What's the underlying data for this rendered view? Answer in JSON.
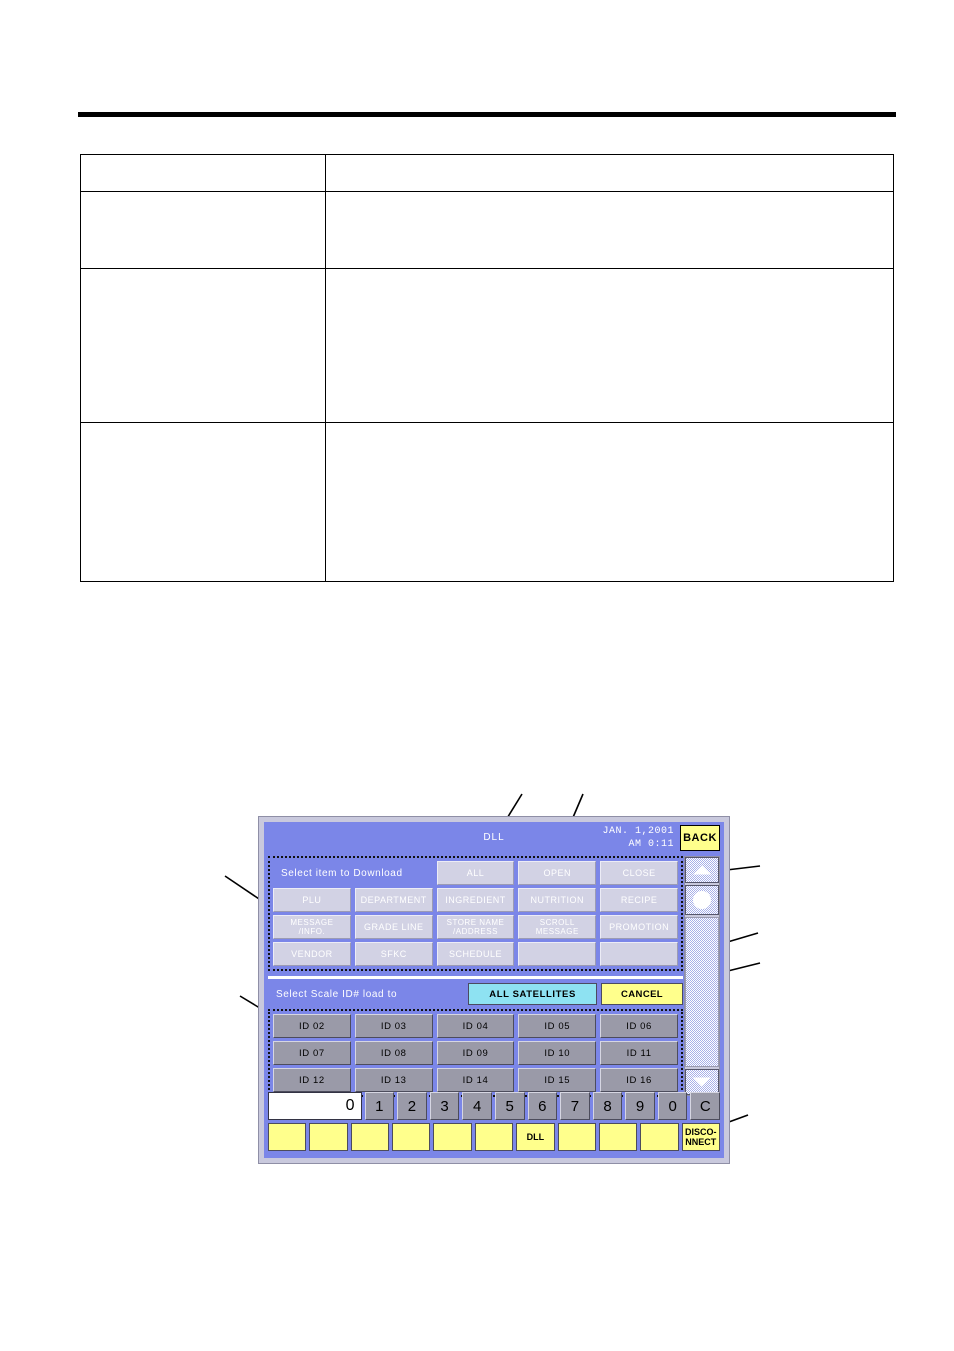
{
  "document": {
    "table": {
      "rows": [
        {
          "left": "",
          "right": ""
        },
        {
          "left": "",
          "right": ""
        },
        {
          "left": "",
          "right": ""
        }
      ]
    }
  },
  "device": {
    "titlebar": {
      "title": "DLL",
      "date": "JAN. 1,2001",
      "time": "AM 0:11",
      "back_label": "BACK"
    },
    "download_group": {
      "label": "Select item to Download",
      "top_buttons": [
        "ALL",
        "OPEN",
        "CLOSE"
      ],
      "grid": [
        [
          "PLU",
          "DEPARTMENT",
          "INGREDIENT",
          "NUTRITION",
          "RECIPE"
        ],
        [
          "MESSAGE\n/INFO.",
          "GRADE LINE",
          "STORE NAME\n/ADDRESS",
          "SCROLL\nMESSAGE",
          "PROMOTION"
        ],
        [
          "VENDOR",
          "SFKC",
          "SCHEDULE",
          "",
          ""
        ]
      ]
    },
    "scale_group": {
      "label": "Select Scale ID# load to",
      "all_satellites_label": "ALL SATELLITES",
      "cancel_label": "CANCEL",
      "ids": [
        [
          "ID 02",
          "ID 03",
          "ID 04",
          "ID 05",
          "ID 06"
        ],
        [
          "ID 07",
          "ID 08",
          "ID 09",
          "ID 10",
          "ID 11"
        ],
        [
          "ID 12",
          "ID 13",
          "ID 14",
          "ID 15",
          "ID 16"
        ]
      ]
    },
    "scrollbar": {
      "up_icon": "triangle-up-icon",
      "thumb_icon": "circle-thumb-icon",
      "down_icon": "triangle-down-icon"
    },
    "keypad": {
      "display_value": "0",
      "keys": [
        "1",
        "2",
        "3",
        "4",
        "5",
        "6",
        "7",
        "8",
        "9",
        "0",
        "C"
      ],
      "function_keys": [
        "",
        "",
        "",
        "",
        "",
        "",
        "DLL",
        "",
        "",
        "",
        "DISCO-\nNNECT"
      ]
    },
    "colors": {
      "screen_background": "#7b86e8",
      "button_lavender": "#d2d2e4",
      "button_grey": "#9a9aa8",
      "accent_yellow": "#ffff8c",
      "accent_cyan": "#8ee2f2",
      "bezel": "#c9c9dd"
    }
  }
}
